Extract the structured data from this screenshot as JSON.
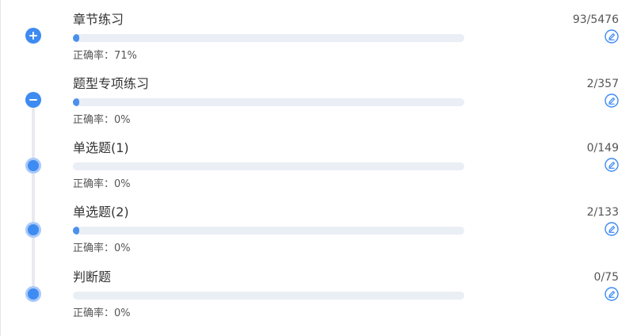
{
  "colors": {
    "accent": "#3e8bf2",
    "accent_light": "#a9c9f8",
    "track": "#eaeef5",
    "timeline": "#e8eaef",
    "text": "#333333"
  },
  "items": [
    {
      "title": "章节练习",
      "count": "93/5476",
      "accuracy_label": "正确率：71%",
      "progress": 0.017,
      "node": "expand",
      "node_icon": "plus-circle-icon",
      "edit_icon": "edit-pencil-icon"
    },
    {
      "title": "题型专项练习",
      "count": "2/357",
      "accuracy_label": "正确率：0%",
      "progress": 0.006,
      "node": "collapse",
      "node_icon": "minus-circle-icon",
      "edit_icon": "edit-pencil-icon"
    },
    {
      "title": "单选题(1)",
      "count": "0/149",
      "accuracy_label": "正确率：0%",
      "progress": 0,
      "node": "dot",
      "node_icon": "dot-icon",
      "edit_icon": "edit-pencil-icon"
    },
    {
      "title": "单选题(2)",
      "count": "2/133",
      "accuracy_label": "正确率：0%",
      "progress": 0.015,
      "node": "dot",
      "node_icon": "dot-icon",
      "edit_icon": "edit-pencil-icon"
    },
    {
      "title": "判断题",
      "count": "0/75",
      "accuracy_label": "正确率：0%",
      "progress": 0,
      "node": "dot",
      "node_icon": "dot-icon",
      "edit_icon": "edit-pencil-icon"
    }
  ]
}
